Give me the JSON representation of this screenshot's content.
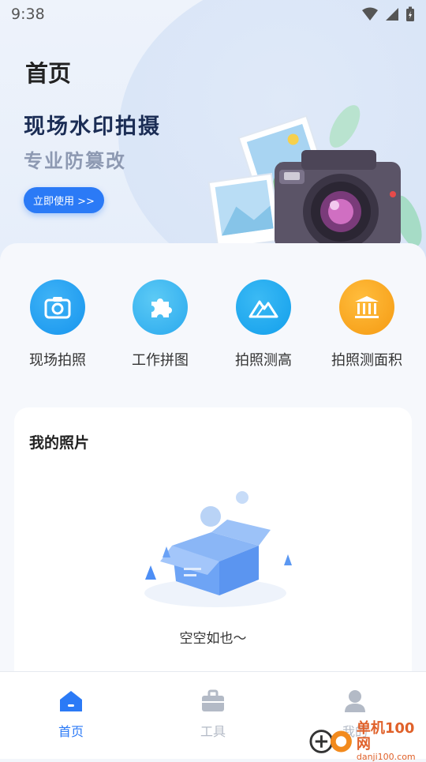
{
  "status_bar": {
    "time": "9:38"
  },
  "header": {
    "title": "首页"
  },
  "hero": {
    "headline": "现场水印拍摄",
    "subline": "专业防篡改",
    "cta_label": "立即使用 >>"
  },
  "quick_actions": [
    {
      "label": "现场拍照",
      "icon": "camera-icon",
      "color": "#1f9df0"
    },
    {
      "label": "工作拼图",
      "icon": "puzzle-icon",
      "color": "#39b6f0"
    },
    {
      "label": "拍照测高",
      "icon": "mountain-icon",
      "color": "#1aa7ee"
    },
    {
      "label": "拍照测面积",
      "icon": "museum-icon",
      "color": "#f7a51e"
    }
  ],
  "photos": {
    "title": "我的照片",
    "empty_text": "空空如也～"
  },
  "bottom_nav": {
    "items": [
      {
        "label": "首页",
        "icon": "home-icon",
        "active": true
      },
      {
        "label": "工具",
        "icon": "toolbox-icon",
        "active": false
      },
      {
        "label": "我的",
        "icon": "person-icon",
        "active": false
      }
    ],
    "active_color": "#2b7af6",
    "inactive_color": "#b3bac6"
  },
  "watermark": {
    "main": "单机100网",
    "sub": "danji100.com"
  }
}
